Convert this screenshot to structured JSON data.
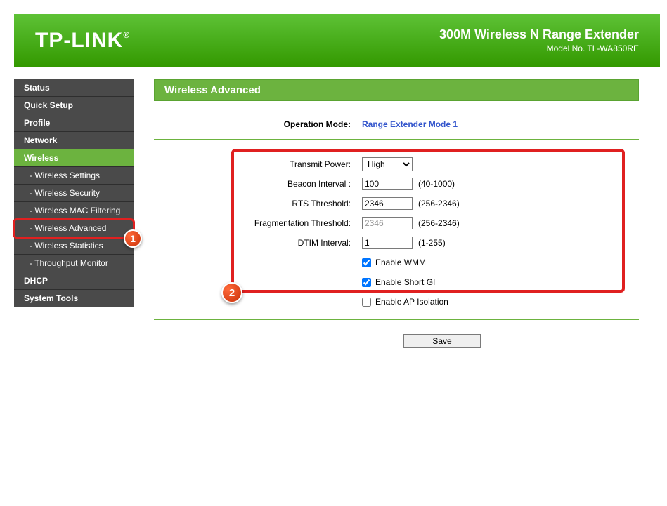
{
  "header": {
    "logo": "TP-LINK",
    "product_title": "300M Wireless N Range Extender",
    "model_no": "Model No. TL-WA850RE"
  },
  "sidebar": {
    "items": [
      {
        "label": "Status",
        "sub": false,
        "active": false
      },
      {
        "label": "Quick Setup",
        "sub": false,
        "active": false
      },
      {
        "label": "Profile",
        "sub": false,
        "active": false
      },
      {
        "label": "Network",
        "sub": false,
        "active": false
      },
      {
        "label": "Wireless",
        "sub": false,
        "active": true
      },
      {
        "label": "- Wireless Settings",
        "sub": true,
        "active": false
      },
      {
        "label": "- Wireless Security",
        "sub": true,
        "active": false
      },
      {
        "label": "- Wireless MAC Filtering",
        "sub": true,
        "active": false
      },
      {
        "label": "- Wireless Advanced",
        "sub": true,
        "active": false,
        "highlight": true
      },
      {
        "label": "- Wireless Statistics",
        "sub": true,
        "active": false
      },
      {
        "label": "- Throughput Monitor",
        "sub": true,
        "active": false
      },
      {
        "label": "DHCP",
        "sub": false,
        "active": false
      },
      {
        "label": "System Tools",
        "sub": false,
        "active": false
      }
    ]
  },
  "annotations": {
    "badge1": "1",
    "badge2": "2"
  },
  "content": {
    "page_title": "Wireless Advanced",
    "op_mode_label": "Operation Mode:",
    "op_mode_value": "Range Extender Mode 1",
    "form": {
      "transmit_power": {
        "label": "Transmit Power:",
        "value": "High"
      },
      "beacon_interval": {
        "label": "Beacon Interval :",
        "value": "100",
        "range": "(40-1000)"
      },
      "rts_threshold": {
        "label": "RTS Threshold:",
        "value": "2346",
        "range": "(256-2346)"
      },
      "frag_threshold": {
        "label": "Fragmentation Threshold:",
        "value": "2346",
        "range": "(256-2346)"
      },
      "dtim_interval": {
        "label": "DTIM Interval:",
        "value": "1",
        "range": "(1-255)"
      },
      "enable_wmm": {
        "label": "Enable WMM",
        "checked": true
      },
      "enable_short_gi": {
        "label": "Enable Short GI",
        "checked": true
      },
      "enable_ap_isolation": {
        "label": "Enable AP Isolation",
        "checked": false
      }
    },
    "save_label": "Save"
  }
}
